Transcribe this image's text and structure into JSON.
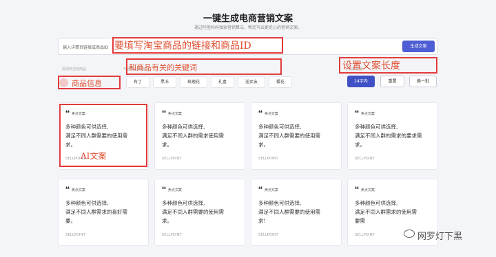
{
  "header": {
    "title": "一键生成电商营销文案",
    "subtitle": "通过阿里妈妈独家营销算法，帮您写出更走心的营销文案。"
  },
  "search": {
    "value": "输入详情页链接或商品ID",
    "button_label": "生成文案"
  },
  "labels": {
    "product": "检测到当前商品",
    "keywords": "可选商品关键词",
    "length": "文案长度"
  },
  "keyword_chips": [
    "有丁",
    "黑冻",
    "玫瑰花",
    "礼盒",
    "送女友",
    "樱花"
  ],
  "controls": {
    "length_button": "24字内",
    "reset_button": "重置",
    "refresh_button": "换一批"
  },
  "annotations": {
    "id_note": "要填写淘宝商品的链接和商品ID",
    "keyword_note": "和商品有关的关键词",
    "length_note": "设置文案长度",
    "product_note": "商品信息",
    "ai_note": "AI文案"
  },
  "cards": [
    {
      "tag": "卖点文案",
      "lines": [
        "多种颜色可供选择,",
        "满足不同人群需要的使用需",
        "求。"
      ],
      "footer": "SELLPOINT"
    },
    {
      "tag": "卖点文案",
      "lines": [
        "多种颜色可供选择,",
        "满足不同人群的需求使用需",
        "求。"
      ],
      "footer": "SELLPOINT"
    },
    {
      "tag": "卖点文案",
      "lines": [
        "多种颜色可供选择,",
        "满足不同人群需要的使用需",
        "求。"
      ],
      "footer": "SELLPOINT"
    },
    {
      "tag": "卖点文案",
      "lines": [
        "多种颜色可供选择,",
        "满足不同人群的需求的要求需",
        "求。"
      ],
      "footer": "SELLPOINT"
    },
    {
      "tag": "卖点文案",
      "lines": [
        "多种颜色可供选择,",
        "满足不同人群需求的喜好需",
        "要。"
      ],
      "footer": "SELLPOINT"
    },
    {
      "tag": "卖点文案",
      "lines": [
        "多种颜色可供选择,",
        "满足不同人群需要的使用需",
        "求。"
      ],
      "footer": "SELLPOINT"
    },
    {
      "tag": "卖点文案",
      "lines": [
        "多种颜色可供选择,",
        "满足不同人群需要的使用需",
        "求!"
      ],
      "footer": "SELLPOINT"
    },
    {
      "tag": "卖点文案",
      "lines": [
        "多种颜色可供选择,",
        "满足不同人群需求的使用需",
        "要需"
      ],
      "footer": "SELLPOINT"
    }
  ],
  "watermark": "网罗灯下黑"
}
